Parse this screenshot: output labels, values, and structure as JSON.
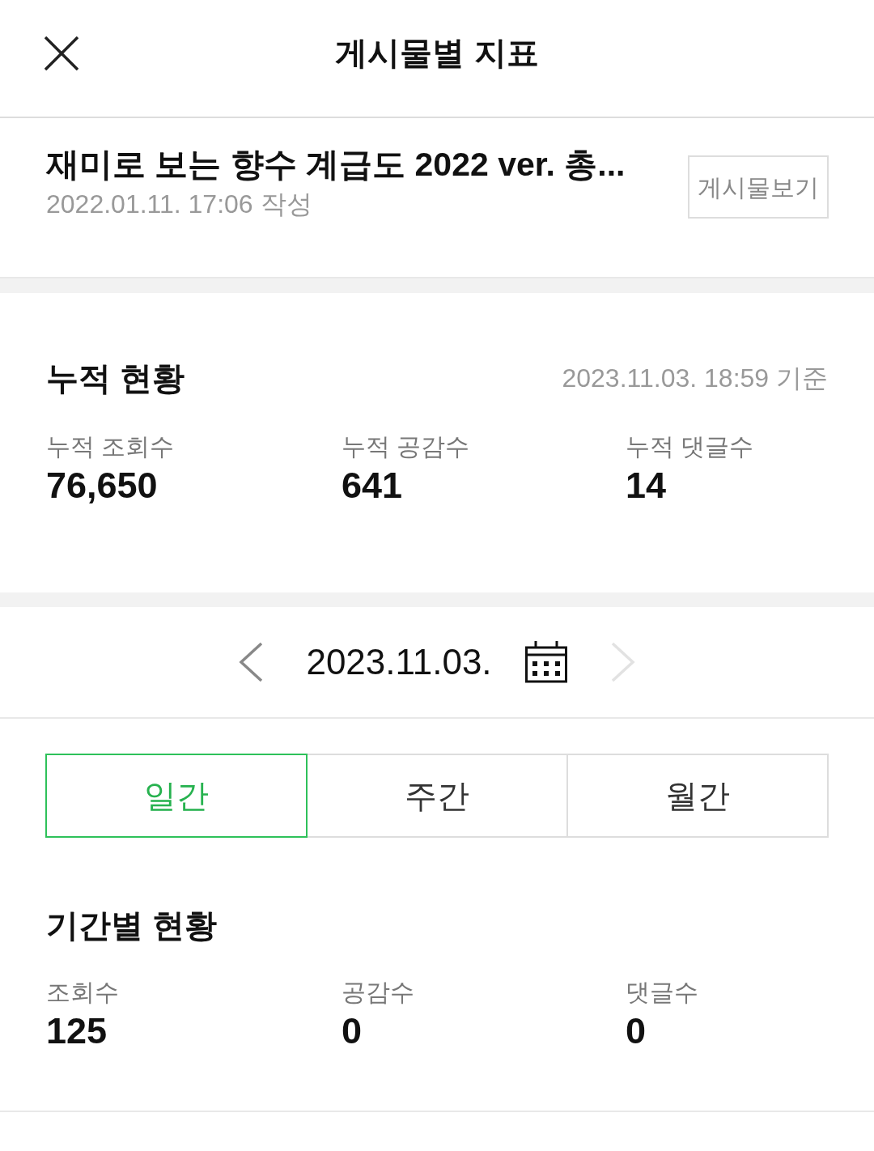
{
  "header": {
    "title": "게시물별 지표"
  },
  "post": {
    "title": "재미로 보는 향수 계급도 2022 ver. 총...",
    "written": "2022.01.11. 17:06 작성",
    "view_button": "게시물보기"
  },
  "cumulative": {
    "heading": "누적 현황",
    "as_of": "2023.11.03. 18:59 기준",
    "stats": [
      {
        "label": "누적 조회수",
        "value": "76,650"
      },
      {
        "label": "누적 공감수",
        "value": "641"
      },
      {
        "label": "누적 댓글수",
        "value": "14"
      }
    ]
  },
  "date_nav": {
    "date": "2023.11.03.",
    "prev": {
      "disabled": false
    },
    "next": {
      "disabled": true
    }
  },
  "period_tabs": [
    {
      "label": "일간",
      "selected": true
    },
    {
      "label": "주간",
      "selected": false
    },
    {
      "label": "월간",
      "selected": false
    }
  ],
  "period": {
    "heading": "기간별 현황",
    "stats": [
      {
        "label": "조회수",
        "value": "125"
      },
      {
        "label": "공감수",
        "value": "0"
      },
      {
        "label": "댓글수",
        "value": "0"
      }
    ]
  }
}
